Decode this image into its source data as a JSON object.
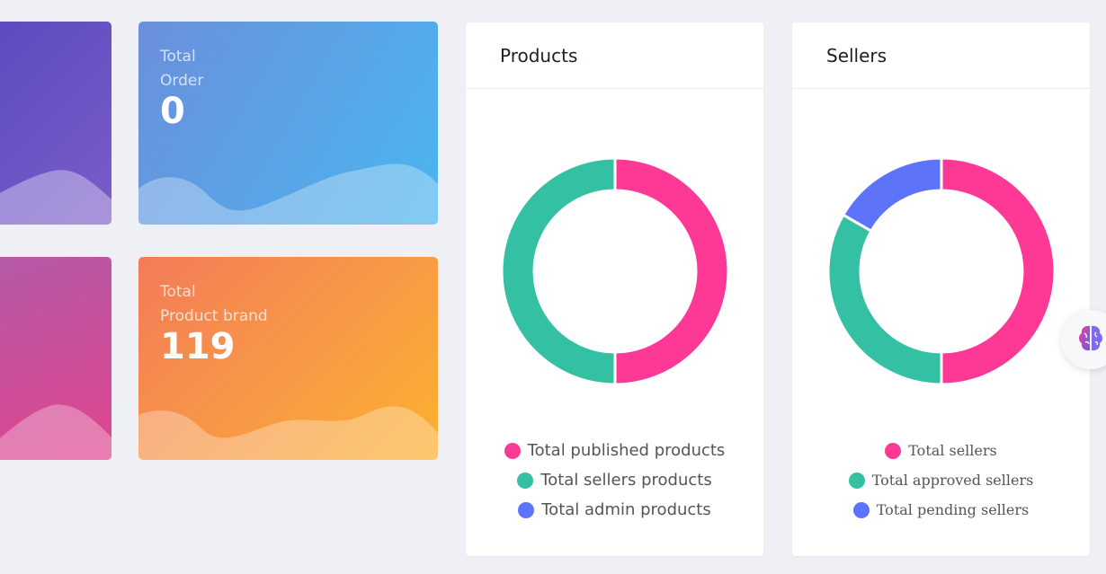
{
  "colors": {
    "pink": "#fd3995",
    "green": "#34c0a2",
    "blue": "#5d74fa"
  },
  "stats": {
    "order": {
      "label": "Total\nOrder",
      "value": "0"
    },
    "brand": {
      "label": "Total\nProduct brand",
      "value": "119"
    }
  },
  "products_panel": {
    "title": "Products",
    "legend": [
      {
        "label": "Total published products",
        "color": "#fd3995"
      },
      {
        "label": "Total sellers products",
        "color": "#34c0a2"
      },
      {
        "label": "Total admin products",
        "color": "#5d74fa"
      }
    ]
  },
  "sellers_panel": {
    "title": "Sellers",
    "legend": [
      {
        "label": "Total sellers",
        "color": "#fd3995"
      },
      {
        "label": "Total approved sellers",
        "color": "#34c0a2"
      },
      {
        "label": "Total pending sellers",
        "color": "#5d74fa"
      }
    ]
  },
  "chart_data": [
    {
      "type": "pie",
      "title": "Products",
      "categories": [
        "Total published products",
        "Total sellers products",
        "Total admin products"
      ],
      "values": [
        50,
        50,
        0
      ],
      "colors": [
        "#fd3995",
        "#34c0a2",
        "#5d74fa"
      ],
      "legend": "bottom"
    },
    {
      "type": "pie",
      "title": "Sellers",
      "categories": [
        "Total sellers",
        "Total approved sellers",
        "Total pending sellers"
      ],
      "values": [
        50,
        33.3,
        16.7
      ],
      "colors": [
        "#fd3995",
        "#34c0a2",
        "#5d74fa"
      ],
      "legend": "bottom"
    }
  ],
  "floating_button_icon": "brain-icon"
}
